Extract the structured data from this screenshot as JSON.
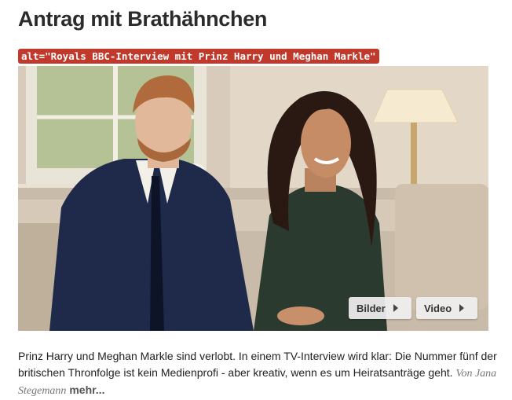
{
  "article": {
    "headline": "Antrag mit Brathähnchen",
    "alt_text": "alt=\"Royals BBC-Interview mit Prinz Harry und Meghan Markle\"",
    "media_buttons": {
      "pictures_label": "Bilder",
      "video_label": "Video"
    },
    "teaser_text": "Prinz Harry und Meghan Markle sind verlobt. In einem TV-Interview wird klar: Die Nummer fünf der britischen Thronfolge ist kein Medienprofi - aber kreativ, wenn es um Heiratsanträge geht.",
    "author": "Von Jana Stegemann",
    "more_link": "mehr..."
  },
  "colors": {
    "alt_tag_bg": "#c0392b",
    "headline": "#2b2b2b"
  },
  "icons": {
    "button_arrow": "play-triangle-icon"
  }
}
